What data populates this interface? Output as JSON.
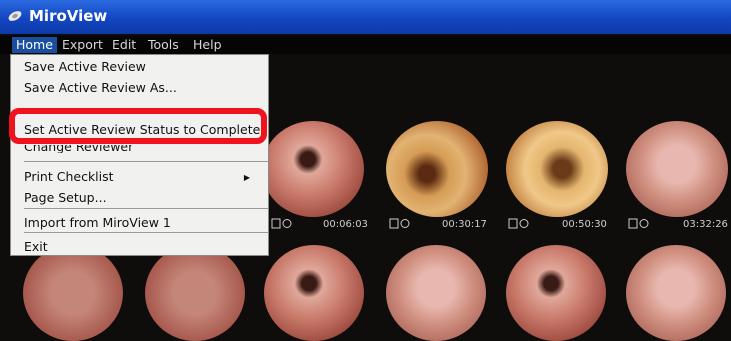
{
  "window": {
    "title": "MiroView"
  },
  "menubar": {
    "items": [
      "Home",
      "Export",
      "Edit",
      "Tools",
      "Help"
    ]
  },
  "home_menu": {
    "items": [
      "Save Active Review",
      "Save Active Review As...",
      "Set Active Review Status to Complete",
      "Change Reviewer",
      "Print Checklist",
      "Page Setup...",
      "Import from MiroView 1",
      "Exit"
    ]
  },
  "thumbnails": {
    "timestamps": [
      "00:06:03",
      "00:30:17",
      "00:50:30",
      "03:32:26"
    ]
  },
  "colors": {
    "highlight": "#f0121d",
    "titlebar": "#1346c2"
  }
}
